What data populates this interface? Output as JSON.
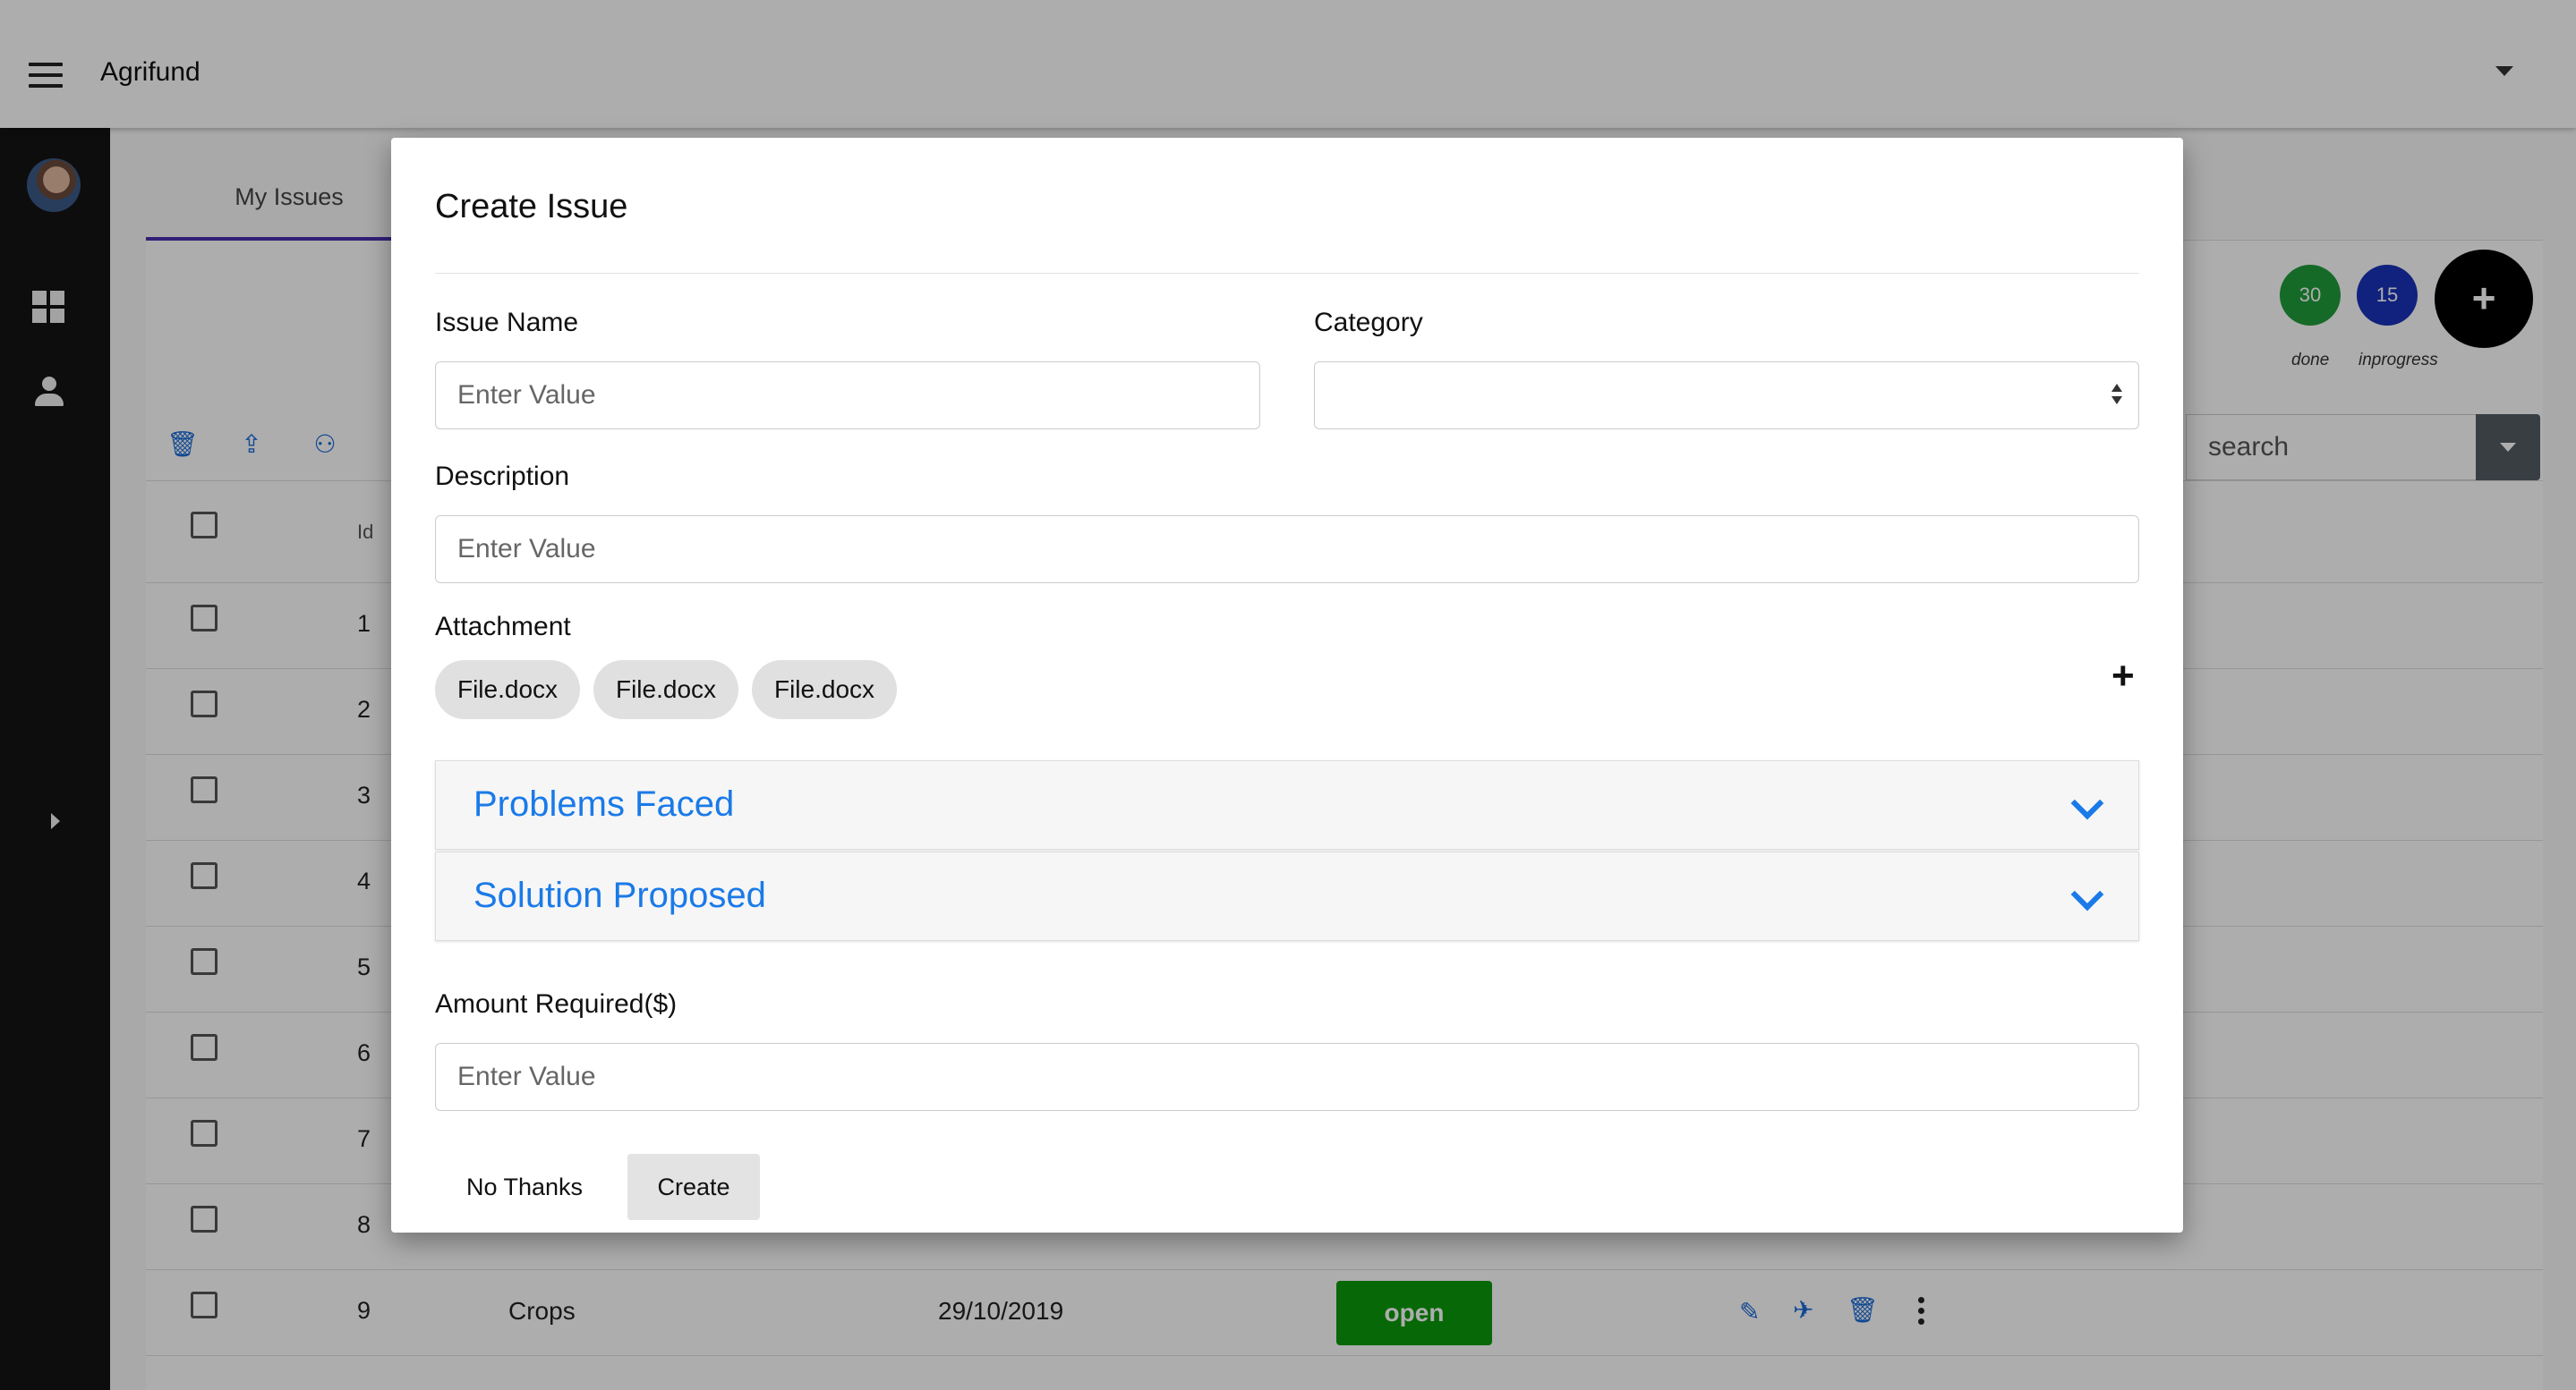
{
  "app": {
    "title": "Agrifund"
  },
  "tabs": {
    "my_issues": "My Issues"
  },
  "stats": [
    {
      "value": "30",
      "label": "done",
      "color": "#1f9d3a"
    },
    {
      "value": "15",
      "label": "inprogress",
      "color": "#1833b8"
    }
  ],
  "add_button": "+",
  "search": {
    "placeholder": "search"
  },
  "table": {
    "id_header": "Id",
    "rows": [
      {
        "id": "1"
      },
      {
        "id": "2"
      },
      {
        "id": "3"
      },
      {
        "id": "4"
      },
      {
        "id": "5"
      },
      {
        "id": "6"
      },
      {
        "id": "7"
      },
      {
        "id": "8"
      },
      {
        "id": "9",
        "category": "Crops",
        "date": "29/10/2019",
        "status": "open",
        "status_color": "#0a9a0a"
      }
    ]
  },
  "modal": {
    "title": "Create Issue",
    "issue_name_label": "Issue Name",
    "issue_name_placeholder": "Enter Value",
    "category_label": "Category",
    "description_label": "Description",
    "description_placeholder": "Enter Value",
    "attachment_label": "Attachment",
    "attachments": [
      "File.docx",
      "File.docx",
      "File.docx"
    ],
    "add_attachment": "+",
    "accordions": [
      "Problems Faced",
      "Solution Proposed"
    ],
    "amount_label": "Amount Required($)",
    "amount_placeholder": "Enter Value",
    "no_thanks": "No Thanks",
    "create": "Create"
  }
}
